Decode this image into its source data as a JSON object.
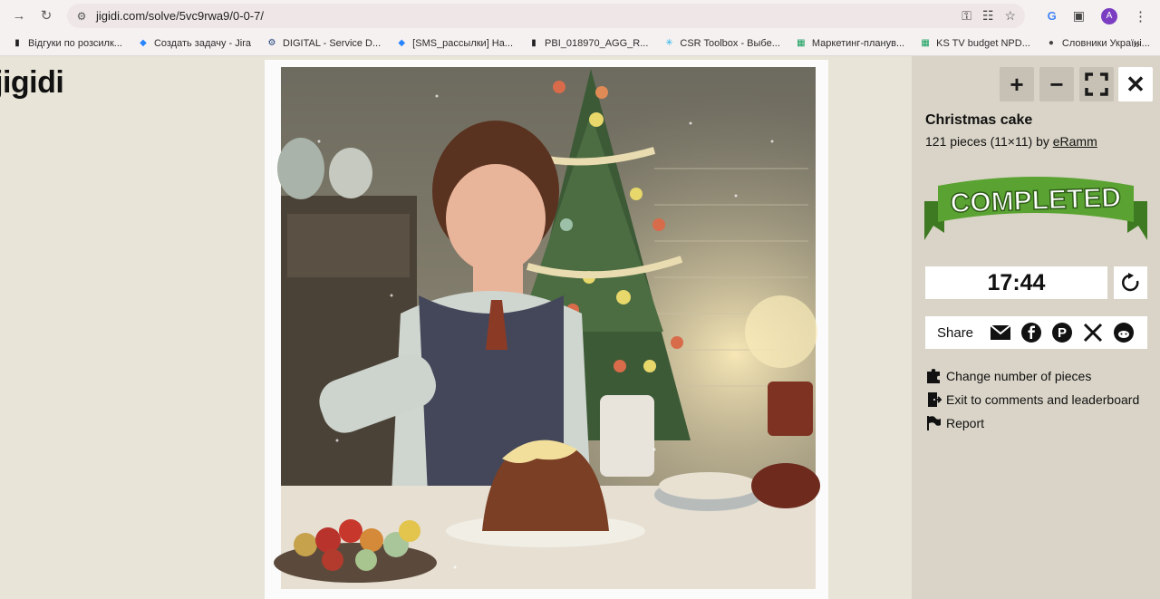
{
  "browser": {
    "url": "jigidi.com/solve/5vc9rwa9/0-0-7/",
    "profile_initial": "A",
    "bookmarks": [
      {
        "label": "Відгуки по розсилк...",
        "icon": "bar-chart-icon",
        "color": "#222222"
      },
      {
        "label": "Создать задачу - Jira",
        "icon": "jira-icon",
        "color": "#2684ff"
      },
      {
        "label": "DIGITAL - Service D...",
        "icon": "service-desk-icon",
        "color": "#1a3d7a"
      },
      {
        "label": "[SMS_рассылки] На...",
        "icon": "jira-icon",
        "color": "#2684ff"
      },
      {
        "label": "PBI_018970_AGG_R...",
        "icon": "bar-chart-icon",
        "color": "#222222"
      },
      {
        "label": "CSR Toolbox - Выбе...",
        "icon": "snowflake-icon",
        "color": "#29b5e8"
      },
      {
        "label": "Маркетинг-планув...",
        "icon": "sheets-icon",
        "color": "#0f9d58"
      },
      {
        "label": "KS TV budget NPD...",
        "icon": "sheets-icon",
        "color": "#0f9d58"
      },
      {
        "label": "Словники Україні...",
        "icon": "globe-icon",
        "color": "#444444"
      }
    ],
    "more_glyph": "»"
  },
  "site": {
    "logo": "jigidi"
  },
  "controls": {
    "zoom_in": "+",
    "zoom_out": "−",
    "close": "✕"
  },
  "puzzle": {
    "title": "Christmas cake",
    "pieces_text": "121 pieces (11×11) by ",
    "author": "eRamm",
    "completed_label": "COMPLETED",
    "timer": "17:44"
  },
  "share": {
    "label": "Share",
    "networks": [
      "email-icon",
      "facebook-icon",
      "pinterest-icon",
      "x-icon",
      "reddit-icon"
    ]
  },
  "links": [
    {
      "label": "Change number of pieces",
      "icon": "puzzle-piece-icon"
    },
    {
      "label": "Exit to comments and leaderboard",
      "icon": "exit-icon"
    },
    {
      "label": "Report",
      "icon": "flag-icon"
    }
  ],
  "colors": {
    "page_bg": "#e8e4d8",
    "sidebar_bg": "#d9d4c7",
    "ribbon_green": "#5aa332",
    "ribbon_dark": "#3e7a22"
  }
}
